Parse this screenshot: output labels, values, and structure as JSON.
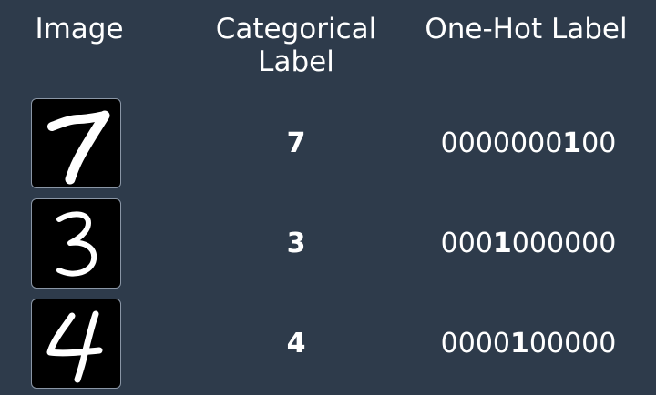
{
  "headers": {
    "image": "Image",
    "categorical_line1": "Categorical",
    "categorical_line2": "Label",
    "one_hot": "One-Hot Label"
  },
  "rows": [
    {
      "digit_image": "handwritten-7",
      "categorical": "7",
      "one_hot": "0000000100",
      "hot_index": 7
    },
    {
      "digit_image": "handwritten-3",
      "categorical": "3",
      "one_hot": "0001000000",
      "hot_index": 3
    },
    {
      "digit_image": "handwritten-4",
      "categorical": "4",
      "one_hot": "0000100000",
      "hot_index": 4
    }
  ],
  "colors": {
    "background": "#2e3b4b",
    "text": "#ffffff",
    "thumb_background": "#000000",
    "thumb_border": "#8a96a6"
  }
}
